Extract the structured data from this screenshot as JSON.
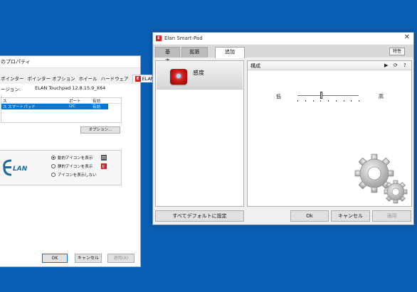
{
  "props_window": {
    "title": "のプロパティ",
    "tabs": [
      "ポインター",
      "ポインター オプション",
      "ホイール",
      "ハードウェア",
      "ELAN"
    ],
    "version_label": "ージョン:",
    "version_value": "ELAN Touchpad 12.8.15.9_X64",
    "devices_label": ":",
    "table_headers": [
      "ス",
      "ポート",
      "有効"
    ],
    "table_row": [
      "ス スマートパッド",
      "I2C",
      "有効"
    ],
    "options_button": "オプション...",
    "radios": [
      {
        "label": "動的アイコンを表示",
        "checked": true
      },
      {
        "label": "静的アイコンを表示",
        "checked": false
      },
      {
        "label": "アイコンを表示しない",
        "checked": false
      }
    ],
    "logo_text": "LAN",
    "ok": "OK",
    "cancel": "キャンセル",
    "apply": "適用(A)"
  },
  "main_window": {
    "title": "Elan Smart-Pad",
    "close_glyph": "✕",
    "tabs": [
      "基本",
      "拡張",
      "追加"
    ],
    "active_tab": "追加",
    "tokusei_button": "特性",
    "left_items": [
      {
        "label": "感度",
        "icon": "sensitivity-icon"
      }
    ],
    "right_header": "構成",
    "header_controls": [
      "▶",
      "⟳",
      "?"
    ],
    "slider": {
      "low_label": "低",
      "high_label": "高",
      "value": 0.38
    },
    "defaults_button": "すべてデフォルトに設定",
    "ok": "Ok",
    "cancel": "キャンセル",
    "apply": "適用"
  },
  "colors": {
    "desktop": "#0a5fb4",
    "selection": "#0078d7",
    "elan_red": "#d62020"
  }
}
